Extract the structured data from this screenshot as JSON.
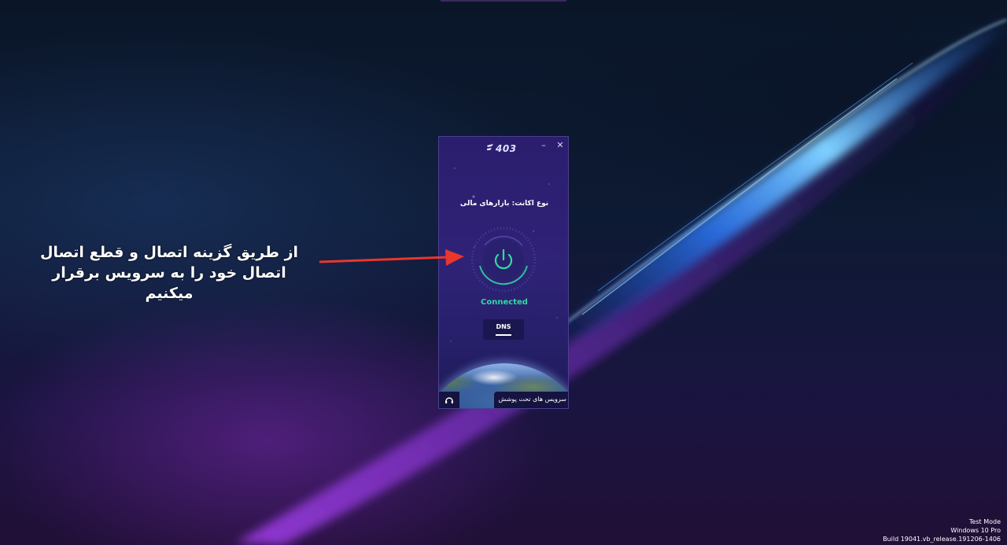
{
  "app": {
    "logo_text": "403",
    "minimize_label": "–",
    "close_label": "✕",
    "account_line": "نوع اکانت: بازارهای مالی",
    "status": "Connected",
    "status_color": "#33d9a3",
    "dns_label": "DNS",
    "covered_services_label": "سرویس های تحت پوشش",
    "support_icon": "headset-icon",
    "power_icon": "power-icon"
  },
  "annotation": {
    "text": "از طریق گزینه اتصال و قطع اتصال اتصال خود را به سرویس برقرار میکنیم",
    "arrow_color": "#e8372b"
  },
  "watermark": {
    "line1": "Test Mode",
    "line2": "Windows 10 Pro",
    "line3": "Build 19041.vb_release.191206-1406"
  }
}
